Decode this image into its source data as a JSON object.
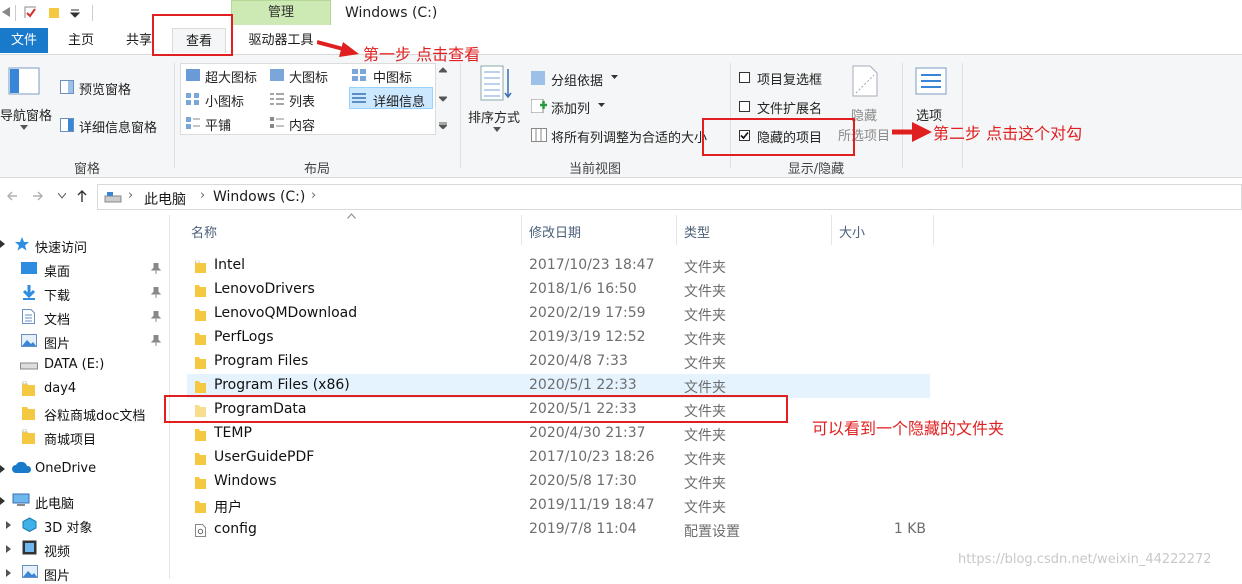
{
  "window": {
    "title": "Windows (C:)",
    "context_tab": "管理"
  },
  "ribbon_tabs": [
    {
      "label": "文件"
    },
    {
      "label": "主页"
    },
    {
      "label": "共享"
    },
    {
      "label": "查看"
    },
    {
      "label": "驱动器工具"
    }
  ],
  "ribbon": {
    "panes": {
      "nav_pane": "导航窗格",
      "preview_pane": "预览窗格",
      "details_pane": "详细信息窗格",
      "group_label": "窗格"
    },
    "layout": {
      "items": [
        "超大图标",
        "大图标",
        "中图标",
        "小图标",
        "列表",
        "详细信息",
        "平铺",
        "内容"
      ],
      "selected": "详细信息",
      "group_label": "布局"
    },
    "current_view": {
      "sort_by": "排序方式",
      "group_by": "分组依据",
      "add_column": "添加列",
      "fit_columns": "将所有列调整为合适的大小",
      "group_label": "当前视图"
    },
    "show_hide": {
      "item_checkboxes": "项目复选框",
      "file_extensions": "文件扩展名",
      "hidden_items": "隐藏的项目",
      "hidden_items_checked": true,
      "hide_selected": "隐藏",
      "selected_items": "所选项目",
      "group_label": "显示/隐藏"
    },
    "options": {
      "label": "选项"
    }
  },
  "address": {
    "crumbs": [
      "此电脑",
      "Windows (C:)"
    ]
  },
  "nav_pane": {
    "quick_access": "快速访问",
    "items": [
      "桌面",
      "下载",
      "文档",
      "图片",
      "DATA (E:)",
      "day4",
      "谷粒商城doc文档",
      "商城项目"
    ],
    "onedrive": "OneDrive",
    "this_pc": "此电脑",
    "pc_items": [
      "3D 对象",
      "视频",
      "图片"
    ]
  },
  "columns": {
    "name": "名称",
    "modified": "修改日期",
    "type": "类型",
    "size": "大小"
  },
  "files": [
    {
      "name": "Intel",
      "date": "2017/10/23 18:47",
      "type": "文件夹",
      "size": ""
    },
    {
      "name": "LenovoDrivers",
      "date": "2018/1/6 16:50",
      "type": "文件夹",
      "size": ""
    },
    {
      "name": "LenovoQMDownload",
      "date": "2020/2/19 17:59",
      "type": "文件夹",
      "size": ""
    },
    {
      "name": "PerfLogs",
      "date": "2019/3/19 12:52",
      "type": "文件夹",
      "size": ""
    },
    {
      "name": "Program Files",
      "date": "2020/4/8 7:33",
      "type": "文件夹",
      "size": ""
    },
    {
      "name": "Program Files (x86)",
      "date": "2020/5/1 22:33",
      "type": "文件夹",
      "size": ""
    },
    {
      "name": "ProgramData",
      "date": "2020/5/1 22:33",
      "type": "文件夹",
      "size": ""
    },
    {
      "name": "TEMP",
      "date": "2020/4/30 21:37",
      "type": "文件夹",
      "size": ""
    },
    {
      "name": "UserGuidePDF",
      "date": "2017/10/23 18:26",
      "type": "文件夹",
      "size": ""
    },
    {
      "name": "Windows",
      "date": "2020/5/8 17:30",
      "type": "文件夹",
      "size": ""
    },
    {
      "name": "用户",
      "date": "2019/11/19 18:47",
      "type": "文件夹",
      "size": ""
    },
    {
      "name": "config",
      "date": "2019/7/8 11:04",
      "type": "配置设置",
      "size": "1 KB"
    }
  ],
  "annotations": {
    "step1": "第一步 点击查看",
    "step2": "第二步 点击这个对勾",
    "note": "可以看到一个隐藏的文件夹"
  },
  "watermark": "https://blog.csdn.net/weixin_44222272",
  "colors": {
    "file_tab": "#1979ca",
    "context_tab": "#cde9b4",
    "annotation": "#e02020",
    "folder": "#f5c842",
    "hover_row": "#e5f3ff"
  }
}
